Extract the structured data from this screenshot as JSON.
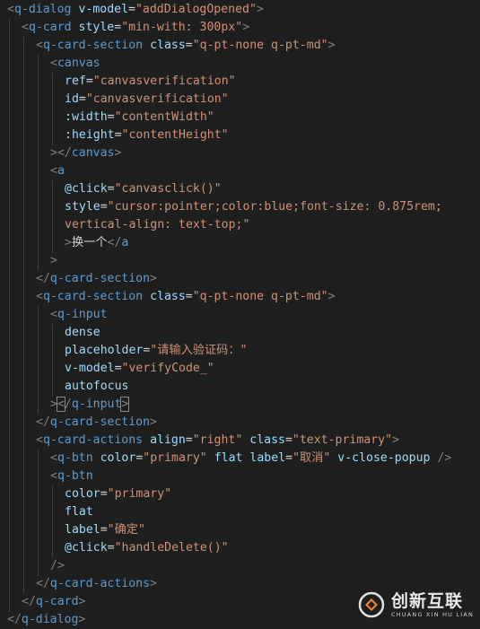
{
  "theme": {
    "background": "#1e1e1e",
    "tag_bracket": "#808080",
    "tag_name": "#569cd6",
    "attribute": "#9cdcfe",
    "string": "#ce9178",
    "text": "#d4d4d4"
  },
  "code_lines": [
    {
      "indent": 0,
      "tokens": [
        [
          "tag-bracket",
          "<"
        ],
        [
          "tag-name",
          "q-dialog"
        ],
        [
          "text",
          " "
        ],
        [
          "attr",
          "v-model"
        ],
        [
          "eq",
          "="
        ],
        [
          "str",
          "\"addDialogOpened\""
        ],
        [
          "tag-bracket",
          ">"
        ]
      ]
    },
    {
      "indent": 1,
      "tokens": [
        [
          "tag-bracket",
          "<"
        ],
        [
          "tag-name",
          "q-card"
        ],
        [
          "text",
          " "
        ],
        [
          "attr",
          "style"
        ],
        [
          "eq",
          "="
        ],
        [
          "str",
          "\"min-with: 300px\""
        ],
        [
          "tag-bracket",
          ">"
        ]
      ]
    },
    {
      "indent": 2,
      "tokens": [
        [
          "tag-bracket",
          "<"
        ],
        [
          "tag-name",
          "q-card-section"
        ],
        [
          "text",
          " "
        ],
        [
          "attr",
          "class"
        ],
        [
          "eq",
          "="
        ],
        [
          "str",
          "\"q-pt-none q-pt-md\""
        ],
        [
          "tag-bracket",
          ">"
        ]
      ]
    },
    {
      "indent": 3,
      "tokens": [
        [
          "tag-bracket",
          "<"
        ],
        [
          "tag-name",
          "canvas"
        ]
      ]
    },
    {
      "indent": 4,
      "tokens": [
        [
          "attr",
          "ref"
        ],
        [
          "eq",
          "="
        ],
        [
          "str",
          "\"canvasverification\""
        ]
      ]
    },
    {
      "indent": 4,
      "tokens": [
        [
          "attr",
          "id"
        ],
        [
          "eq",
          "="
        ],
        [
          "str",
          "\"canvasverification\""
        ]
      ]
    },
    {
      "indent": 4,
      "tokens": [
        [
          "attr",
          ":width"
        ],
        [
          "eq",
          "="
        ],
        [
          "str",
          "\"contentWidth\""
        ]
      ]
    },
    {
      "indent": 4,
      "tokens": [
        [
          "attr",
          ":height"
        ],
        [
          "eq",
          "="
        ],
        [
          "str",
          "\"contentHeight\""
        ]
      ]
    },
    {
      "indent": 3,
      "tokens": [
        [
          "tag-bracket",
          "></"
        ],
        [
          "tag-name",
          "canvas"
        ],
        [
          "tag-bracket",
          ">"
        ]
      ]
    },
    {
      "indent": 3,
      "tokens": [
        [
          "tag-bracket",
          "<"
        ],
        [
          "tag-name",
          "a"
        ]
      ]
    },
    {
      "indent": 4,
      "tokens": [
        [
          "attr",
          "@click"
        ],
        [
          "eq",
          "="
        ],
        [
          "str",
          "\"canvasclick()\""
        ]
      ]
    },
    {
      "indent": 4,
      "tokens": [
        [
          "attr",
          "style"
        ],
        [
          "eq",
          "="
        ],
        [
          "str",
          "\"cursor:pointer;color:blue;font-size: 0.875rem;"
        ]
      ]
    },
    {
      "indent": 4,
      "tokens": [
        [
          "str",
          "vertical-align: text-top;\""
        ]
      ]
    },
    {
      "indent": 4,
      "tokens": [
        [
          "tag-bracket",
          ">"
        ],
        [
          "text",
          "换一个"
        ],
        [
          "tag-bracket",
          "</"
        ],
        [
          "tag-name",
          "a"
        ]
      ]
    },
    {
      "indent": 3,
      "tokens": [
        [
          "tag-bracket",
          ">"
        ]
      ]
    },
    {
      "indent": 2,
      "tokens": [
        [
          "tag-bracket",
          "</"
        ],
        [
          "tag-name",
          "q-card-section"
        ],
        [
          "tag-bracket",
          ">"
        ]
      ]
    },
    {
      "indent": 2,
      "tokens": [
        [
          "tag-bracket",
          "<"
        ],
        [
          "tag-name",
          "q-card-section"
        ],
        [
          "text",
          " "
        ],
        [
          "attr",
          "class"
        ],
        [
          "eq",
          "="
        ],
        [
          "str",
          "\"q-pt-none q-pt-md\""
        ],
        [
          "tag-bracket",
          ">"
        ]
      ]
    },
    {
      "indent": 3,
      "tokens": [
        [
          "tag-bracket",
          "<"
        ],
        [
          "tag-name",
          "q-input"
        ]
      ]
    },
    {
      "indent": 4,
      "tokens": [
        [
          "attr",
          "dense"
        ]
      ]
    },
    {
      "indent": 4,
      "tokens": [
        [
          "attr",
          "placeholder"
        ],
        [
          "eq",
          "="
        ],
        [
          "str",
          "\"请输入验证码：\""
        ]
      ]
    },
    {
      "indent": 4,
      "tokens": [
        [
          "attr",
          "v-model"
        ],
        [
          "eq",
          "="
        ],
        [
          "str",
          "\"verifyCode_\""
        ]
      ]
    },
    {
      "indent": 4,
      "tokens": [
        [
          "attr",
          "autofocus"
        ]
      ]
    },
    {
      "indent": 3,
      "cursor": true,
      "tokens": [
        [
          "tag-bracket",
          ">"
        ],
        [
          "tag-bracket cursor-box",
          "<"
        ],
        [
          "tag-bracket",
          "/"
        ],
        [
          "tag-name",
          "q-input"
        ],
        [
          "tag-bracket cursor-box",
          ">"
        ]
      ]
    },
    {
      "indent": 2,
      "tokens": [
        [
          "tag-bracket",
          "</"
        ],
        [
          "tag-name",
          "q-card-section"
        ],
        [
          "tag-bracket",
          ">"
        ]
      ]
    },
    {
      "indent": 2,
      "tokens": [
        [
          "tag-bracket",
          "<"
        ],
        [
          "tag-name",
          "q-card-actions"
        ],
        [
          "text",
          " "
        ],
        [
          "attr",
          "align"
        ],
        [
          "eq",
          "="
        ],
        [
          "str",
          "\"right\""
        ],
        [
          "text",
          " "
        ],
        [
          "attr",
          "class"
        ],
        [
          "eq",
          "="
        ],
        [
          "str",
          "\"text-primary\""
        ],
        [
          "tag-bracket",
          ">"
        ]
      ]
    },
    {
      "indent": 3,
      "tokens": [
        [
          "tag-bracket",
          "<"
        ],
        [
          "tag-name",
          "q-btn"
        ],
        [
          "text",
          " "
        ],
        [
          "attr",
          "color"
        ],
        [
          "eq",
          "="
        ],
        [
          "str",
          "\"primary\""
        ],
        [
          "text",
          " "
        ],
        [
          "attr",
          "flat"
        ],
        [
          "text",
          " "
        ],
        [
          "attr",
          "label"
        ],
        [
          "eq",
          "="
        ],
        [
          "str",
          "\"取消\""
        ],
        [
          "text",
          " "
        ],
        [
          "attr",
          "v-close-popup"
        ],
        [
          "text",
          " "
        ],
        [
          "tag-bracket",
          "/>"
        ]
      ]
    },
    {
      "indent": 3,
      "tokens": [
        [
          "tag-bracket",
          "<"
        ],
        [
          "tag-name",
          "q-btn"
        ]
      ]
    },
    {
      "indent": 4,
      "tokens": [
        [
          "attr",
          "color"
        ],
        [
          "eq",
          "="
        ],
        [
          "str",
          "\"primary\""
        ]
      ]
    },
    {
      "indent": 4,
      "tokens": [
        [
          "attr",
          "flat"
        ]
      ]
    },
    {
      "indent": 4,
      "tokens": [
        [
          "attr",
          "label"
        ],
        [
          "eq",
          "="
        ],
        [
          "str",
          "\"确定\""
        ]
      ]
    },
    {
      "indent": 4,
      "tokens": [
        [
          "attr",
          "@click"
        ],
        [
          "eq",
          "="
        ],
        [
          "str",
          "\"handleDelete()\""
        ]
      ]
    },
    {
      "indent": 3,
      "tokens": [
        [
          "tag-bracket",
          "/>"
        ]
      ]
    },
    {
      "indent": 2,
      "tokens": [
        [
          "tag-bracket",
          "</"
        ],
        [
          "tag-name",
          "q-card-actions"
        ],
        [
          "tag-bracket",
          ">"
        ]
      ]
    },
    {
      "indent": 1,
      "tokens": [
        [
          "tag-bracket",
          "</"
        ],
        [
          "tag-name",
          "q-card"
        ],
        [
          "tag-bracket",
          ">"
        ]
      ]
    },
    {
      "indent": 0,
      "tokens": [
        [
          "tag-bracket",
          "</"
        ],
        [
          "tag-name",
          "q-dialog"
        ],
        [
          "tag-bracket",
          ">"
        ]
      ]
    }
  ],
  "watermark": {
    "brand_cn": "创新互联",
    "brand_pinyin": "CHUANG XIN HU LIAN"
  }
}
